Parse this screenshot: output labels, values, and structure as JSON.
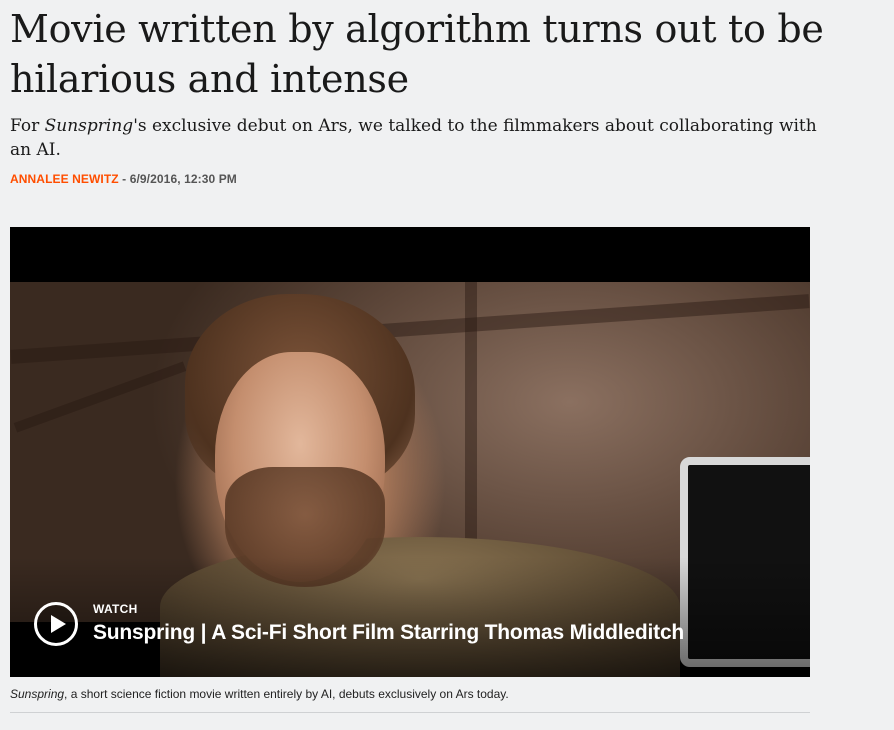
{
  "article": {
    "headline": "Movie written by algorithm turns out to be hilarious and intense",
    "dek_prefix": "For ",
    "dek_italic": "Sunspring",
    "dek_suffix": "'s exclusive debut on Ars, we talked to the filmmakers about collaborating with an AI.",
    "author": "ANNALEE NEWITZ",
    "byline_separator": " - ",
    "date": "6/9/2016, 12:30 PM"
  },
  "video": {
    "watch_label": "WATCH",
    "title": "Sunspring | A Sci-Fi Short Film Starring Thomas Middleditch",
    "play_icon": "play-icon"
  },
  "caption": {
    "italic": "Sunspring",
    "text": ", a short science fiction movie written entirely by AI, debuts exclusively on Ars today."
  },
  "colors": {
    "author_accent": "#ff4e00",
    "page_background": "#f0f1f2",
    "video_background": "#000000"
  }
}
